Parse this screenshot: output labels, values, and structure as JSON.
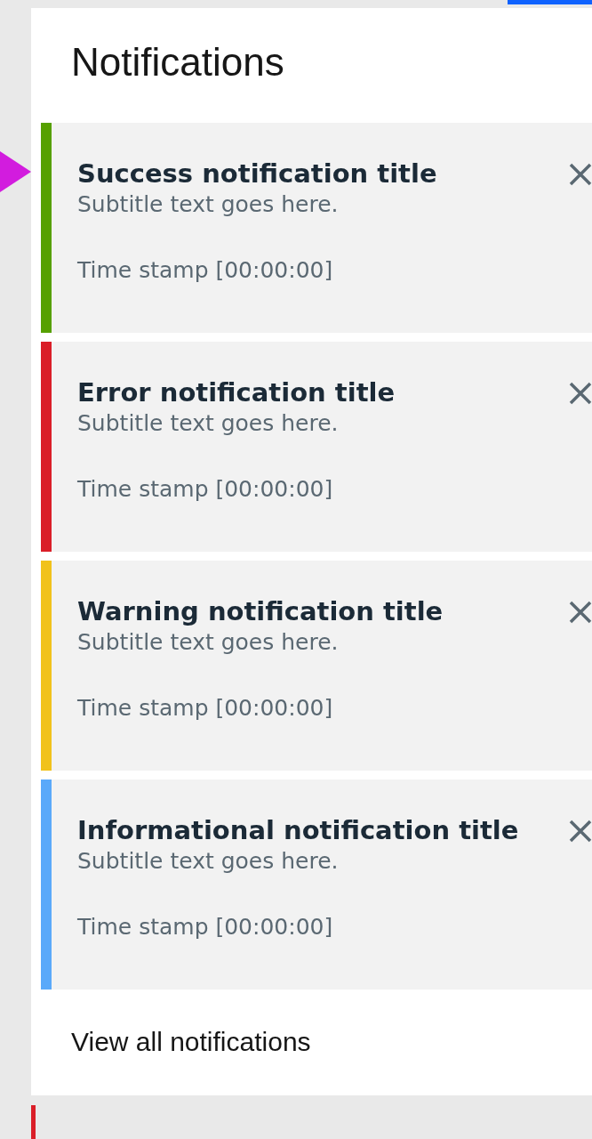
{
  "panel": {
    "title": "Notifications",
    "footer_link": "View all notifications"
  },
  "notifications": [
    {
      "title": "Success notification title",
      "subtitle": "Subtitle text goes here.",
      "timestamp": "Time stamp [00:00:00]",
      "color": "#56a000"
    },
    {
      "title": "Error notification title",
      "subtitle": "Subtitle text goes here.",
      "timestamp": "Time stamp [00:00:00]",
      "color": "#da1e28"
    },
    {
      "title": "Warning notification title",
      "subtitle": "Subtitle text goes here.",
      "timestamp": "Time stamp [00:00:00]",
      "color": "#f1c21b"
    },
    {
      "title": "Informational notification title",
      "subtitle": "Subtitle text goes here.",
      "timestamp": "Time stamp [00:00:00]",
      "color": "#5aa9fa"
    }
  ]
}
